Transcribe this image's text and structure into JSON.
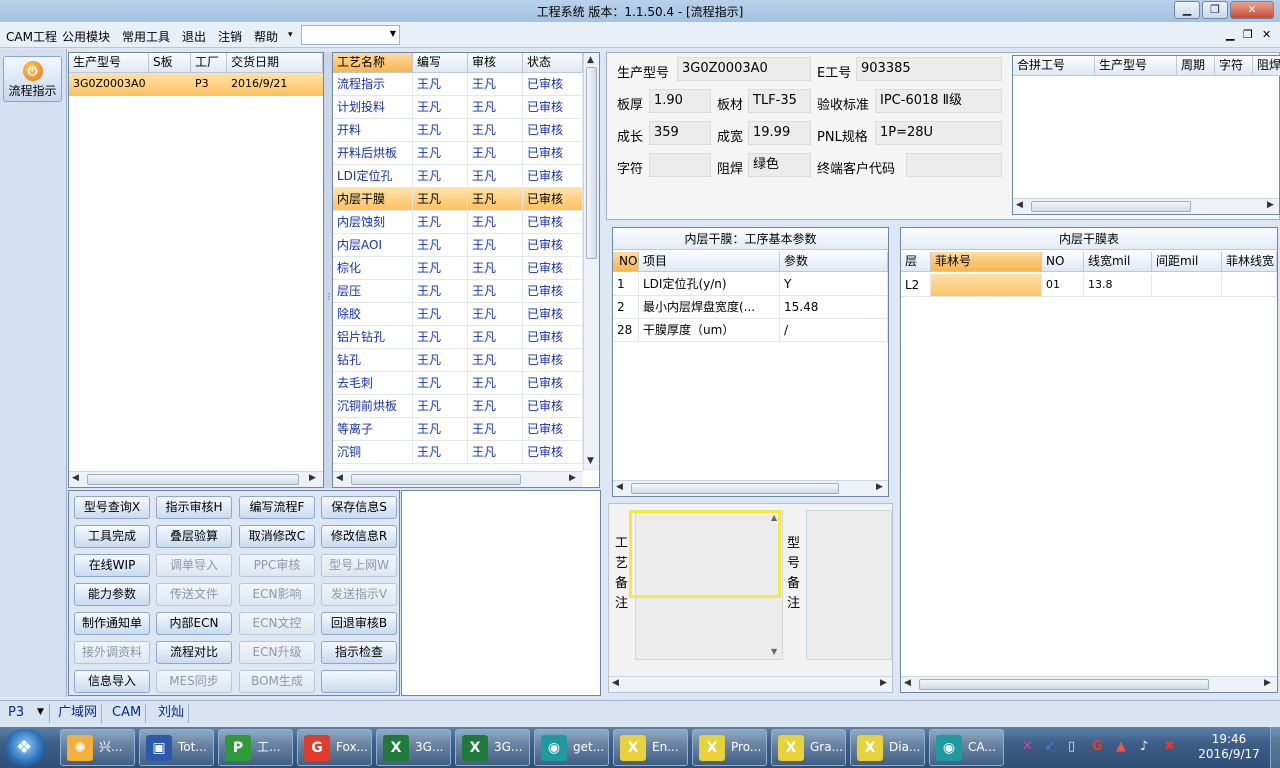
{
  "window": {
    "title": "工程系统  版本：1.1.50.4 - [流程指示]"
  },
  "menu": {
    "items": [
      "CAM工程",
      "公用模块",
      "常用工具",
      "退出",
      "注销",
      "帮助"
    ],
    "help_arrow": "▾",
    "combo_value": ""
  },
  "nav": {
    "label": "流程指示",
    "icon": "power-icon"
  },
  "models": {
    "headers": [
      "生产型号",
      "S板",
      "工厂",
      "交货日期"
    ],
    "rows": [
      {
        "model": "3G0Z0003A0",
        "s": "",
        "factory": "P3",
        "date": "2016/9/21"
      }
    ]
  },
  "process": {
    "headers": [
      "工艺名称",
      "编写",
      "审核",
      "状态"
    ],
    "rows": [
      {
        "name": "流程指示",
        "writer": "王凡",
        "reviewer": "王凡",
        "status": "已审核"
      },
      {
        "name": "计划投料",
        "writer": "王凡",
        "reviewer": "王凡",
        "status": "已审核"
      },
      {
        "name": "开料",
        "writer": "王凡",
        "reviewer": "王凡",
        "status": "已审核"
      },
      {
        "name": "开料后烘板",
        "writer": "王凡",
        "reviewer": "王凡",
        "status": "已审核"
      },
      {
        "name": "LDI定位孔",
        "writer": "王凡",
        "reviewer": "王凡",
        "status": "已审核"
      },
      {
        "name": "内层干膜",
        "writer": "王凡",
        "reviewer": "王凡",
        "status": "已审核"
      },
      {
        "name": "内层蚀刻",
        "writer": "王凡",
        "reviewer": "王凡",
        "status": "已审核"
      },
      {
        "name": "内层AOI",
        "writer": "王凡",
        "reviewer": "王凡",
        "status": "已审核"
      },
      {
        "name": "棕化",
        "writer": "王凡",
        "reviewer": "王凡",
        "status": "已审核"
      },
      {
        "name": "层压",
        "writer": "王凡",
        "reviewer": "王凡",
        "status": "已审核"
      },
      {
        "name": "除胶",
        "writer": "王凡",
        "reviewer": "王凡",
        "status": "已审核"
      },
      {
        "name": "铝片钻孔",
        "writer": "王凡",
        "reviewer": "王凡",
        "status": "已审核"
      },
      {
        "name": "钻孔",
        "writer": "王凡",
        "reviewer": "王凡",
        "status": "已审核"
      },
      {
        "name": "去毛刺",
        "writer": "王凡",
        "reviewer": "王凡",
        "status": "已审核"
      },
      {
        "name": "沉铜前烘板",
        "writer": "王凡",
        "reviewer": "王凡",
        "status": "已审核"
      },
      {
        "name": "等离子",
        "writer": "王凡",
        "reviewer": "王凡",
        "status": "已审核"
      },
      {
        "name": "沉铜",
        "writer": "王凡",
        "reviewer": "王凡",
        "status": "已审核"
      }
    ],
    "selected_index": 5
  },
  "buttons": [
    {
      "label": "型号查询X",
      "enabled": true
    },
    {
      "label": "指示审核H",
      "enabled": true
    },
    {
      "label": "编写流程F",
      "enabled": true
    },
    {
      "label": "保存信息S",
      "enabled": true
    },
    {
      "label": "工具完成",
      "enabled": true
    },
    {
      "label": "叠层验算",
      "enabled": true
    },
    {
      "label": "取消修改C",
      "enabled": true
    },
    {
      "label": "修改信息R",
      "enabled": true
    },
    {
      "label": "在线WIP",
      "enabled": true
    },
    {
      "label": "调单导入",
      "enabled": false
    },
    {
      "label": "PPC审核",
      "enabled": false
    },
    {
      "label": "型号上网W",
      "enabled": false
    },
    {
      "label": "能力参数",
      "enabled": true
    },
    {
      "label": "传送文件",
      "enabled": false
    },
    {
      "label": "ECN影响",
      "enabled": false
    },
    {
      "label": "发送指示V",
      "enabled": false
    },
    {
      "label": "制作通知单",
      "enabled": true
    },
    {
      "label": "内部ECN",
      "enabled": true
    },
    {
      "label": "ECN文控",
      "enabled": false
    },
    {
      "label": "回退审核B",
      "enabled": true
    },
    {
      "label": "接外调资料",
      "enabled": false
    },
    {
      "label": "流程对比",
      "enabled": true
    },
    {
      "label": "ECN升级",
      "enabled": false
    },
    {
      "label": "指示检查",
      "enabled": true
    },
    {
      "label": "信息导入",
      "enabled": true
    },
    {
      "label": "MES同步",
      "enabled": false
    },
    {
      "label": "BOM生成",
      "enabled": false
    },
    {
      "label": "",
      "enabled": true
    }
  ],
  "info": {
    "model_label": "生产型号",
    "model_value": "3G0Z0003A0",
    "e_label": "E工号",
    "e_value": "903385",
    "thickness_label": "板厚",
    "thickness_value": "1.90",
    "material_label": "板材",
    "material_value": "TLF-35",
    "standard_label": "验收标准",
    "standard_value": "IPC-6018 Ⅱ级",
    "length_label": "成长",
    "length_value": "359",
    "width_label": "成宽",
    "width_value": "19.99",
    "pnl_label": "PNL规格",
    "pnl_value": "1P=28U",
    "char_label": "字符",
    "char_value": "",
    "mask_label": "阻焊",
    "mask_value": "绿色",
    "customer_label": "终端客户代码",
    "customer_value": ""
  },
  "merge": {
    "headers": [
      "合拼工号",
      "生产型号",
      "周期",
      "字符",
      "阻焊"
    ]
  },
  "params": {
    "title": "内层干膜：工序基本参数",
    "headers": [
      "NO",
      "项目",
      "参数"
    ],
    "rows": [
      {
        "no": "1",
        "item": "LDI定位孔(y/n)",
        "value": "Y"
      },
      {
        "no": "2",
        "item": "最小内层焊盘宽度(...",
        "value": "15.48"
      },
      {
        "no": "28",
        "item": "干膜厚度（um）",
        "value": "/"
      }
    ]
  },
  "film": {
    "title": "内层干膜表",
    "headers": [
      "层",
      "菲林号",
      "NO",
      "线宽mil",
      "间距mil",
      "菲林线宽"
    ],
    "rows": [
      {
        "layer": "L2",
        "film": "",
        "no": "01",
        "line": "13.8",
        "space": "",
        "film_line": ""
      }
    ]
  },
  "notes": {
    "process_label": "工艺备注",
    "model_label": "型号备注"
  },
  "status": {
    "factory": "P3",
    "network": "广域网",
    "dept": "CAM",
    "user": "刘灿"
  },
  "taskbar": {
    "items": [
      {
        "label": "兴...",
        "icon": "shell-icon"
      },
      {
        "label": "Tot...",
        "icon": "floppy-icon"
      },
      {
        "label": "工...",
        "icon": "p-app-icon"
      },
      {
        "label": "Fox...",
        "icon": "foxmail-icon"
      },
      {
        "label": "3G...",
        "icon": "excel-icon"
      },
      {
        "label": "3G...",
        "icon": "excel-icon"
      },
      {
        "label": "get...",
        "icon": "cam-eye-icon"
      },
      {
        "label": "En...",
        "icon": "x-app-icon"
      },
      {
        "label": "Pro...",
        "icon": "x-app-icon"
      },
      {
        "label": "Gra...",
        "icon": "x-app-icon"
      },
      {
        "label": "Dia...",
        "icon": "x-app-icon"
      },
      {
        "label": "CA...",
        "icon": "cam-eye-icon"
      }
    ],
    "time": "19:46",
    "date": "2016/9/17"
  }
}
